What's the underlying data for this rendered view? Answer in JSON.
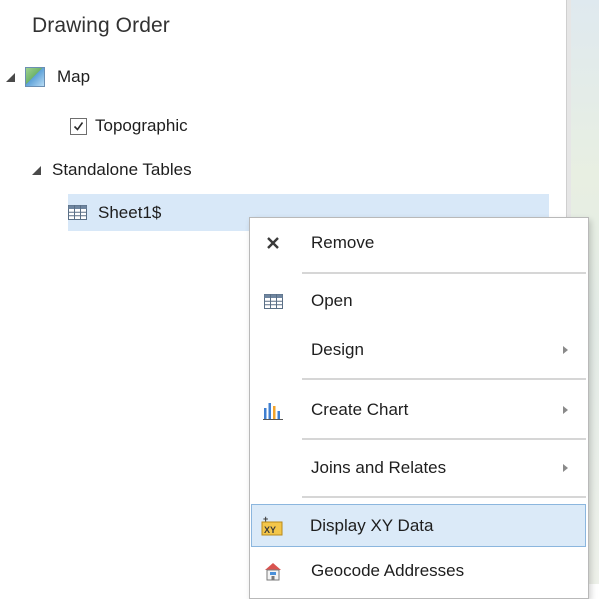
{
  "pane": {
    "title": "Drawing Order",
    "tree": {
      "map_label": "Map",
      "layer_label": "Topographic",
      "layer_checked": true,
      "standalone_label": "Standalone Tables",
      "table_label": "Sheet1$"
    }
  },
  "context_menu": {
    "items": [
      {
        "label": "Remove",
        "icon": "close-icon"
      },
      {
        "label": "Open",
        "icon": "table-icon"
      },
      {
        "label": "Design",
        "icon": "none",
        "submenu": true
      },
      {
        "label": "Create Chart",
        "icon": "bar-chart-icon",
        "submenu": true
      },
      {
        "label": "Joins and Relates",
        "icon": "none",
        "submenu": true
      },
      {
        "label": "Display XY Data",
        "icon": "xy-data-icon",
        "highlighted": true
      },
      {
        "label": "Geocode Addresses",
        "icon": "geocode-icon"
      }
    ]
  },
  "colors": {
    "selection": "#d8e8f8",
    "menu_highlight": "#dbeaf8",
    "menu_highlight_border": "#8bb6de",
    "chart_blue": "#3f7fd0",
    "chart_orange": "#f2a32a"
  }
}
